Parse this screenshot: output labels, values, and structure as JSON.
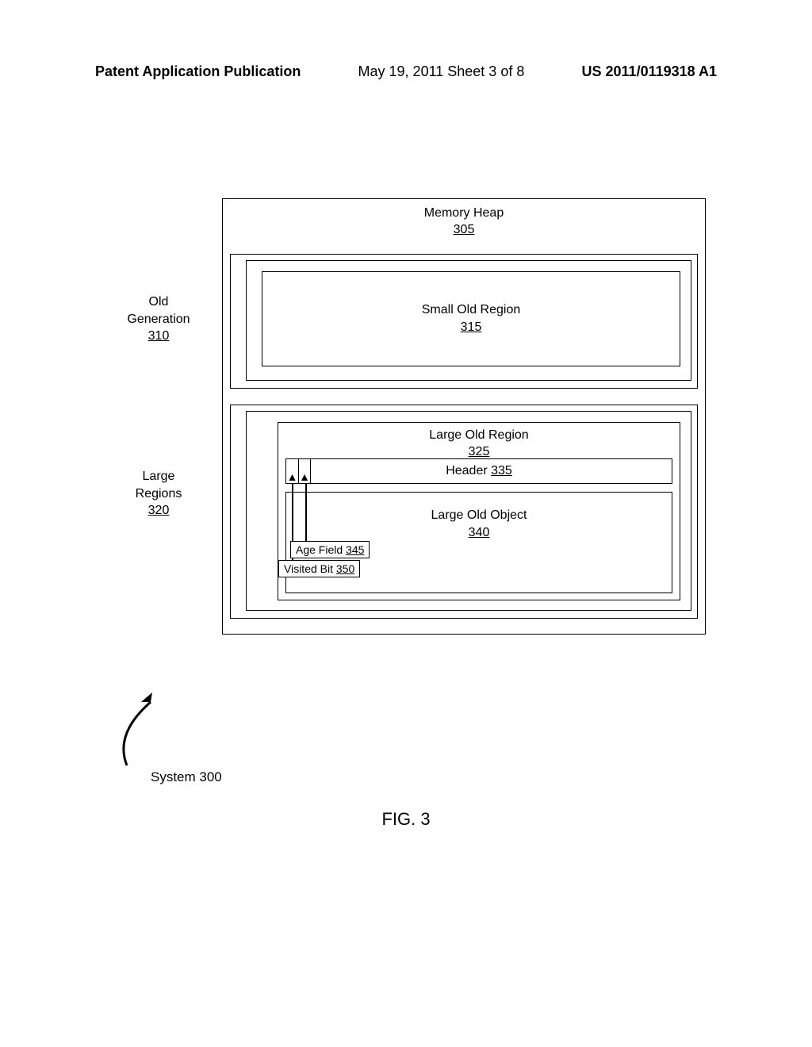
{
  "header": {
    "left": "Patent Application Publication",
    "center": "May 19, 2011  Sheet 3 of 8",
    "right": "US 2011/0119318 A1"
  },
  "diagram": {
    "memory_heap": {
      "label": "Memory Heap",
      "ref": "305"
    },
    "old_generation_side": {
      "label": "Old\nGeneration",
      "ref": "310"
    },
    "small_old_region": {
      "label": "Small Old Region",
      "ref": "315"
    },
    "large_regions_side": {
      "label": "Large\nRegions",
      "ref": "320"
    },
    "large_old_region": {
      "label": "Large Old Region",
      "ref": "325"
    },
    "header_box": {
      "label": "Header ",
      "ref": "335"
    },
    "large_old_object": {
      "label": "Large Old Object",
      "ref": "340"
    },
    "age_field": {
      "label": "Age Field ",
      "ref": "345"
    },
    "visited_bit": {
      "label": "Visited Bit ",
      "ref": "350"
    }
  },
  "system_label": "System 300",
  "figure_label": "FIG. 3"
}
